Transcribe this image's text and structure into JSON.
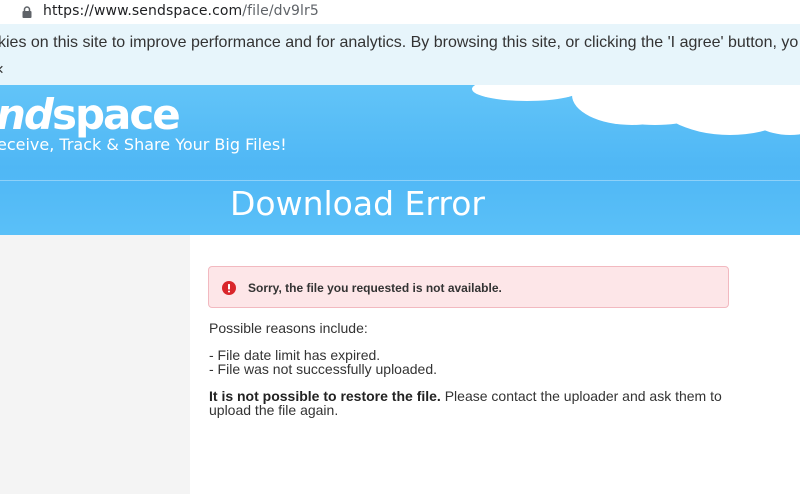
{
  "browser": {
    "url_host": "https://www.sendspace.com",
    "url_path": "/file/dv9lr5"
  },
  "cookie_banner": {
    "text": "kies on this site to improve performance and for analytics. By browsing this site, or clicking the 'I agree' button, yo",
    "close_glyph": "×"
  },
  "header": {
    "logo_prefix": "nd",
    "logo_main": "space",
    "tagline": "eceive, Track & Share Your Big Files!",
    "title": "Download Error"
  },
  "alert": {
    "icon": "exclamation-circle-icon",
    "message": "Sorry, the file you requested is not available."
  },
  "content": {
    "reasons_label": "Possible reasons include:",
    "reasons": [
      "- File date limit has expired.",
      "- File was not successfully uploaded."
    ],
    "restore_bold": "It is not possible to restore the file.",
    "restore_rest": " Please contact the uploader and ask them to",
    "restore_line2": "upload the file again."
  },
  "colors": {
    "header_blue": "#4fb7f5",
    "alert_bg": "#fde6e8",
    "alert_icon": "#d9262b",
    "cookie_bg": "#e7f5fb"
  }
}
